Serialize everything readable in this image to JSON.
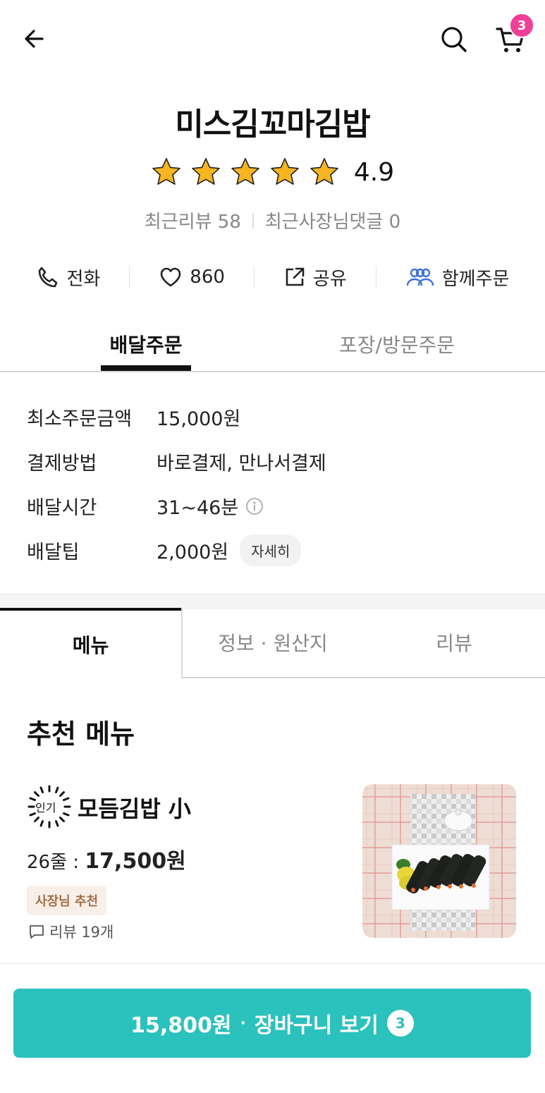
{
  "header": {
    "cart_count": "3",
    "icons": [
      "back-arrow-icon",
      "search-icon",
      "cart-icon"
    ]
  },
  "store": {
    "name": "미스김꼬마김밥",
    "rating": "4.9",
    "stars": 5
  },
  "reviews": {
    "recent_reviews": "최근리뷰 58",
    "owner_replies": "최근사장님댓글 0"
  },
  "actions": {
    "call": "전화",
    "likes": "860",
    "share": "공유",
    "group_order": "함께주문"
  },
  "order_tabs": {
    "delivery": "배달주문",
    "pickup": "포장/방문주문"
  },
  "info": {
    "min_order_label": "최소주문금액",
    "min_order_value": "15,000원",
    "payment_label": "결제방법",
    "payment_value": "바로결제, 만나서결제",
    "time_label": "배달시간",
    "time_value": "31~46분",
    "tip_label": "배달팁",
    "tip_value": "2,000원",
    "tip_detail": "자세히"
  },
  "menu_tabs": {
    "menu": "메뉴",
    "info": "정보 · 원산지",
    "review": "리뷰"
  },
  "section": {
    "title": "추천 메뉴"
  },
  "item": {
    "badge": "인기",
    "name": "모듬김밥 小",
    "qty": "26줄 : ",
    "price": "17,500원",
    "owner_pick": "사장님 추천",
    "review_count": "리뷰 19개"
  },
  "cta": {
    "total": "15,800원",
    "separator": "·",
    "label": "장바구니 보기",
    "count": "3"
  },
  "colors": {
    "accent": "#2bc1bc",
    "badge": "#ef3f98",
    "star": "#f6b521"
  }
}
